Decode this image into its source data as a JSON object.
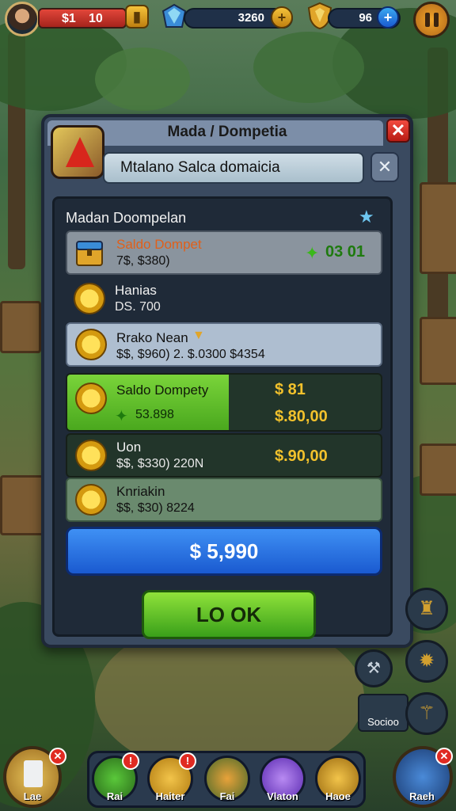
{
  "hud": {
    "hp_left": "$1",
    "hp_right": "10",
    "gems": "3260",
    "shields": "96",
    "plus": "+"
  },
  "dialog": {
    "title": "Mada / Dompetia",
    "close": "✕",
    "search_value": "Mtalano Salca domaicia",
    "search_clear": "✕",
    "inner_title": "Madan Doompelan",
    "rows": [
      {
        "name": "Saldo Dompet",
        "sub": "7$, $380)",
        "amount": "03 01"
      },
      {
        "name": "Hanias",
        "sub": "DS. 700",
        "amount": ""
      },
      {
        "name": "Rrako Nean",
        "sub": "$$, $960) 2. $.0300 $4354",
        "amount": ""
      },
      {
        "name": "Saldo Dompety",
        "sub": "53.898",
        "amount": "$ 81",
        "amount2": "$.80,00"
      },
      {
        "name": "Uon",
        "sub": "$$, $330) 220N",
        "amount": "$.90,00"
      },
      {
        "name": "Knriakin",
        "sub": "$$, $30) 8224",
        "amount": ""
      }
    ],
    "total_button": "$ 5,990",
    "ok_button": "LO OK"
  },
  "side": {
    "panel_label": "Socioo"
  },
  "bottom_nav": [
    {
      "label": "Lae"
    },
    {
      "label": "Rai"
    },
    {
      "label": "Haiter"
    },
    {
      "label": "Fai"
    },
    {
      "label": "Vlaton"
    },
    {
      "label": "Haoe"
    },
    {
      "label": "Raeh"
    }
  ],
  "colors": {
    "accent_blue": "#2a72e6",
    "ok_green": "#5cc02a",
    "close_red": "#d4241a",
    "gold": "#f2c12c"
  }
}
